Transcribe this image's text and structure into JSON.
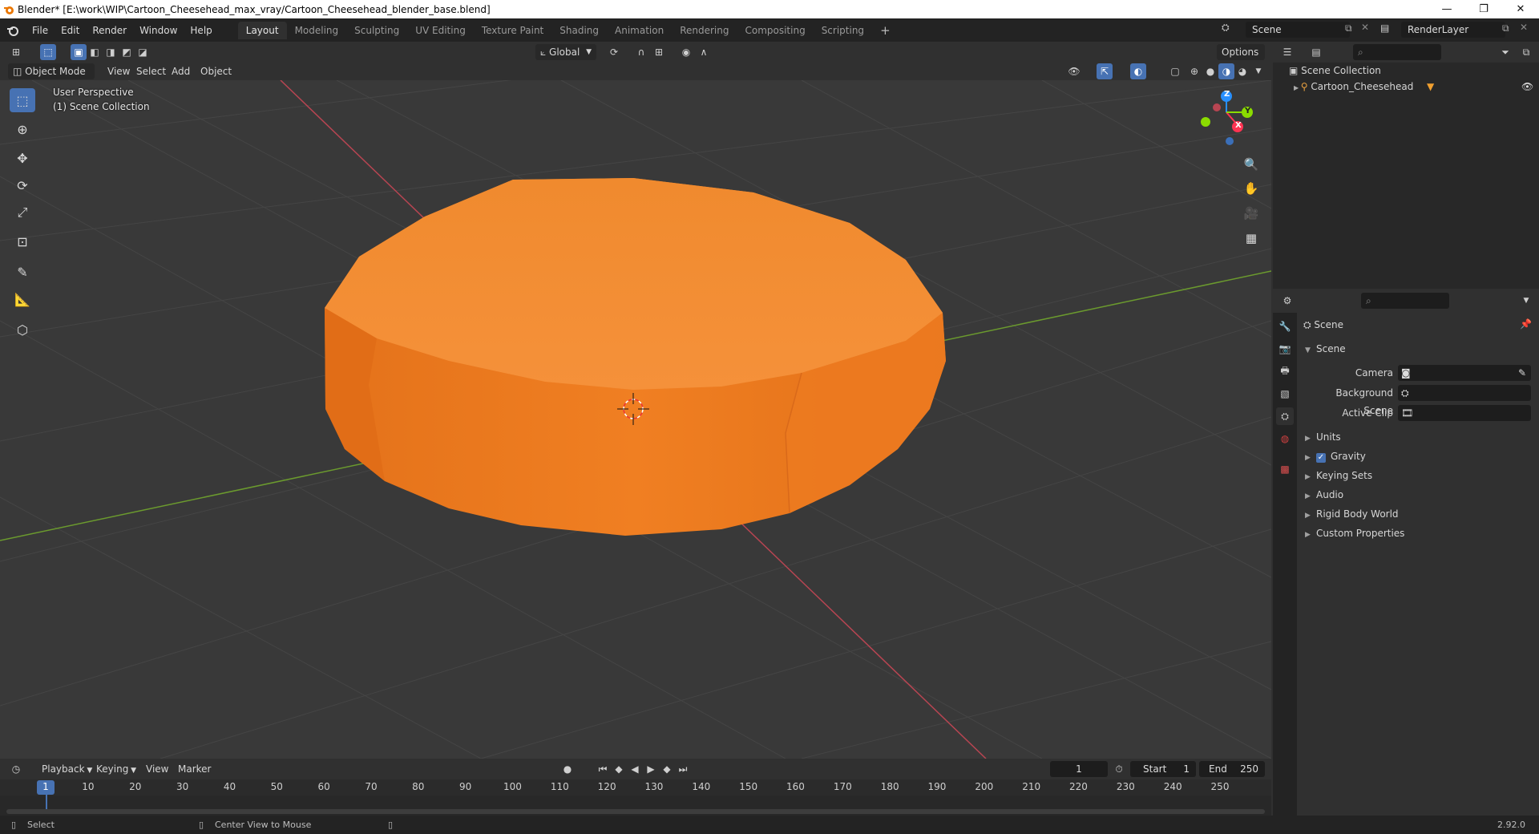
{
  "window": {
    "title": "Blender* [E:\\work\\WIP\\Cartoon_Cheesehead_max_vray/Cartoon_Cheesehead_blender_base.blend]",
    "minimize": "—",
    "maximize": "❐",
    "close": "✕"
  },
  "menu": [
    "File",
    "Edit",
    "Render",
    "Window",
    "Help"
  ],
  "workspaces": [
    "Layout",
    "Modeling",
    "Sculpting",
    "UV Editing",
    "Texture Paint",
    "Shading",
    "Animation",
    "Rendering",
    "Compositing",
    "Scripting"
  ],
  "workspace_add": "+",
  "scene_field": "Scene",
  "renderlayer_field": "RenderLayer",
  "viewport_header": {
    "transform_orientation": "Global",
    "options": "Options",
    "mode": "Object Mode",
    "menus": [
      "View",
      "Select",
      "Add",
      "Object"
    ]
  },
  "viewport": {
    "perspective": "User Perspective",
    "collection": "(1) Scene Collection",
    "gizmo": {
      "x": "X",
      "y": "Y",
      "z": "Z"
    }
  },
  "outliner": {
    "root": "Scene Collection",
    "items": [
      {
        "name": "Cartoon_Cheesehead"
      }
    ]
  },
  "properties": {
    "context_title": "Scene",
    "section": "Scene",
    "fields": [
      {
        "label": "Camera",
        "value": ""
      },
      {
        "label": "Background Scene",
        "value": ""
      },
      {
        "label": "Active Clip",
        "value": ""
      }
    ],
    "subpanels": [
      "Units",
      "Gravity",
      "Keying Sets",
      "Audio",
      "Rigid Body World",
      "Custom Properties"
    ],
    "gravity_checked": true
  },
  "timeline": {
    "menus": [
      "Playback",
      "Keying",
      "View",
      "Marker"
    ],
    "current_frame": "1",
    "start_label": "Start",
    "start": "1",
    "end_label": "End",
    "end": "250",
    "ticks": [
      "1",
      "10",
      "20",
      "30",
      "40",
      "50",
      "60",
      "70",
      "80",
      "90",
      "100",
      "110",
      "120",
      "130",
      "140",
      "150",
      "160",
      "170",
      "180",
      "190",
      "200",
      "210",
      "220",
      "230",
      "240",
      "250"
    ]
  },
  "statusbar": {
    "select": "Select",
    "center": "Center View to Mouse",
    "version": "2.92.0"
  },
  "colors": {
    "accent": "#4772b3",
    "cheese": "#f07f22",
    "x_axis": "#ff3352",
    "y_axis": "#8bdc00",
    "z_axis": "#2890ff"
  }
}
